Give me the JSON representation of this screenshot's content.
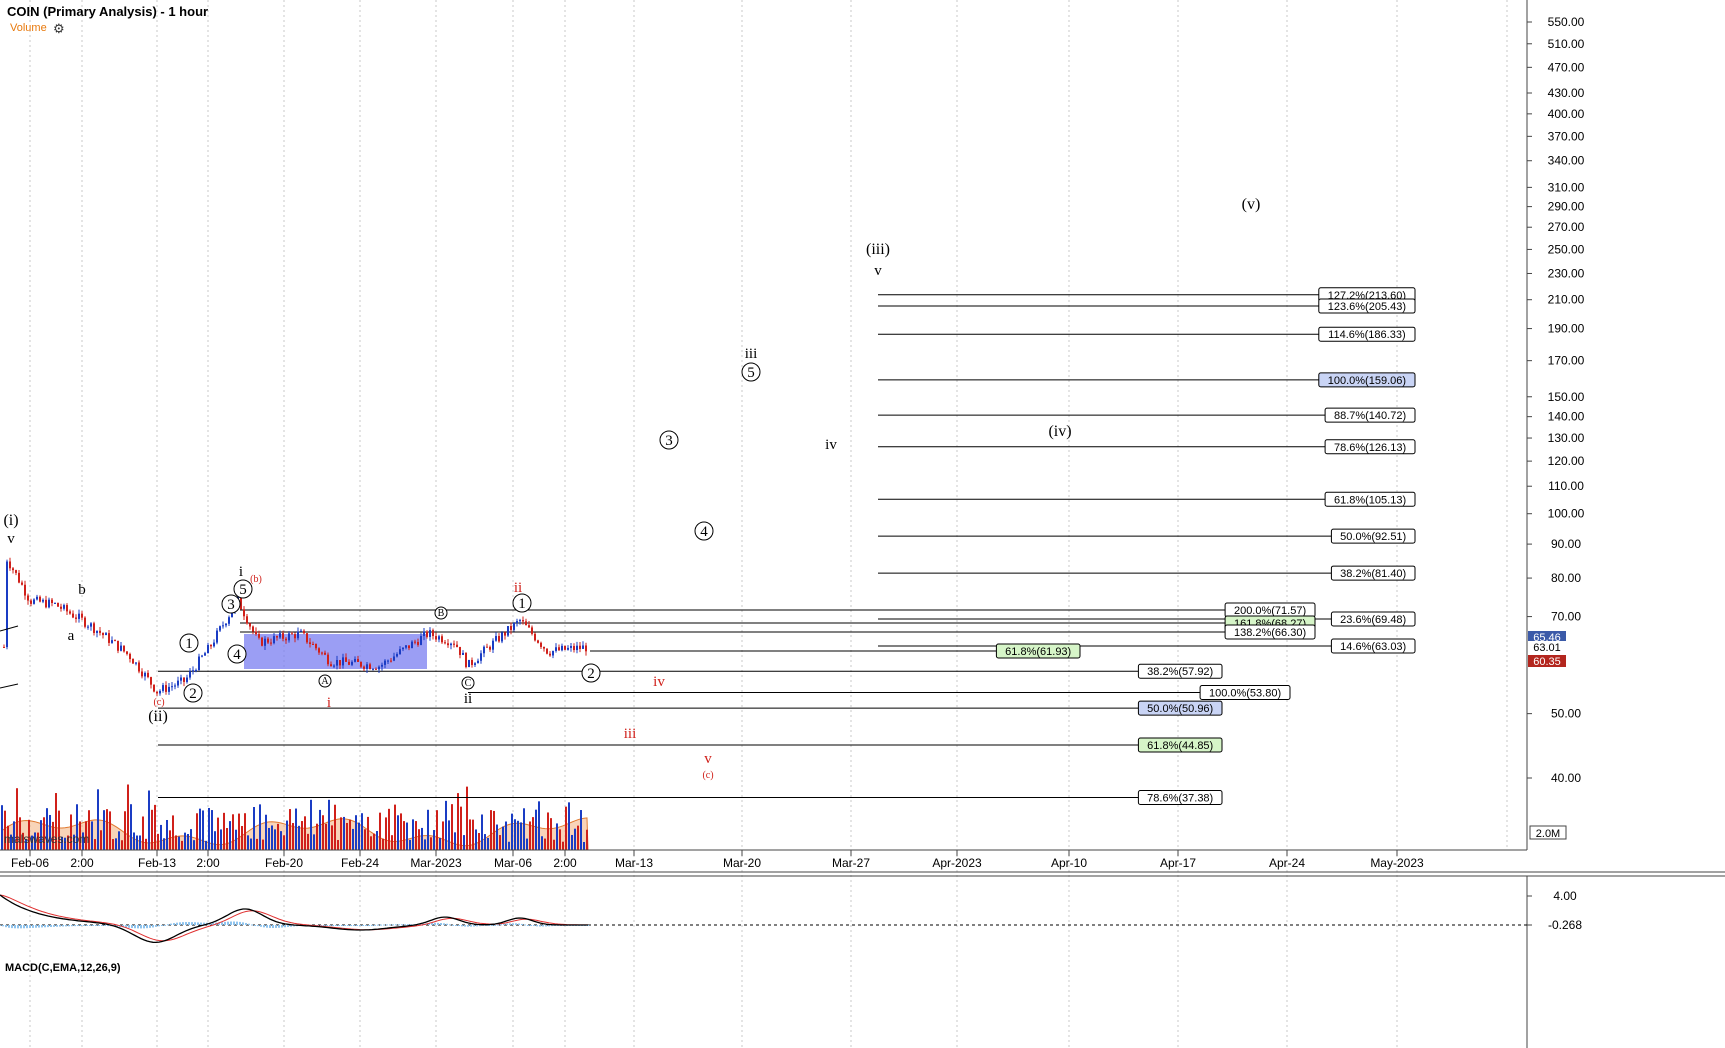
{
  "header": {
    "title": "COIN (Primary Analysis) - 1 hour",
    "volume_label": "Volume",
    "settings_icon": "gear-icon"
  },
  "watermark": "malswaves.com",
  "macd_label": "MACD(C,EMA,12,26,9)",
  "colors": {
    "up": "#1a3cc4",
    "down": "#d0201a",
    "red_label": "#d0201a",
    "box_fill": "#7a7ef0",
    "green_tag": "#d6f5c8",
    "blue_tag": "#c9d4f5",
    "macd_line": "#000000",
    "signal_line": "#e03030",
    "hist": "#8fc4ee",
    "vol_ema": "#f3b07e"
  },
  "chart_data": {
    "type": "candlestick",
    "title": "COIN (Primary Analysis) - 1 hour",
    "scale": "log",
    "ylim": [
      35,
      580
    ],
    "y_ticks": [
      "550.00",
      "510.00",
      "470.00",
      "430.00",
      "400.00",
      "370.00",
      "340.00",
      "310.00",
      "290.00",
      "270.00",
      "250.00",
      "230.00",
      "210.00",
      "190.00",
      "170.00",
      "150.00",
      "140.00",
      "130.00",
      "120.00",
      "110.00",
      "100.00",
      "90.00",
      "80.00",
      "70.00",
      "50.00",
      "40.00"
    ],
    "x_ticks": [
      "Feb-06",
      "2:00",
      "Feb-13",
      "2:00",
      "Feb-20",
      "Feb-24",
      "Mar-2023",
      "Mar-06",
      "2:00",
      "Mar-13",
      "Mar-20",
      "Mar-27",
      "Apr-2023",
      "Apr-10",
      "Apr-17",
      "Apr-24",
      "May-2023"
    ],
    "price_tags": [
      {
        "label": "65.46",
        "style": "blue"
      },
      {
        "label": "63.01",
        "style": "plain"
      },
      {
        "label": "60.35",
        "style": "red"
      }
    ],
    "volume_tag": "2.0M",
    "macd_ticks": [
      "4.00",
      "-0.268"
    ],
    "fib_levels": [
      {
        "label": "127.2%(213.60)",
        "value": 213.6,
        "style": "plain",
        "group": "upper"
      },
      {
        "label": "123.6%(205.43)",
        "value": 205.43,
        "style": "plain",
        "group": "upper"
      },
      {
        "label": "114.6%(186.33)",
        "value": 186.33,
        "style": "plain",
        "group": "upper"
      },
      {
        "label": "100.0%(159.06)",
        "value": 159.06,
        "style": "blue",
        "group": "upper"
      },
      {
        "label": "88.7%(140.72)",
        "value": 140.72,
        "style": "plain",
        "group": "upper"
      },
      {
        "label": "78.6%(126.13)",
        "value": 126.13,
        "style": "plain",
        "group": "upper"
      },
      {
        "label": "61.8%(105.13)",
        "value": 105.13,
        "style": "plain",
        "group": "upper"
      },
      {
        "label": "50.0%(92.51)",
        "value": 92.51,
        "style": "plain",
        "group": "upper"
      },
      {
        "label": "38.2%(81.40)",
        "value": 81.4,
        "style": "plain",
        "group": "upper"
      },
      {
        "label": "23.6%(69.48)",
        "value": 69.48,
        "style": "plain",
        "group": "upper"
      },
      {
        "label": "14.6%(63.03)",
        "value": 63.03,
        "style": "plain",
        "group": "upper"
      },
      {
        "label": "200.0%(71.57)",
        "value": 71.57,
        "style": "plain",
        "group": "mid"
      },
      {
        "label": "161.8%(68.27)",
        "value": 68.27,
        "style": "green",
        "group": "mid"
      },
      {
        "label": "138.2%(66.30)",
        "value": 66.3,
        "style": "plain",
        "group": "mid"
      },
      {
        "label": "61.8%(61.93)",
        "value": 61.93,
        "style": "green",
        "group": "short"
      },
      {
        "label": "38.2%(57.92)",
        "value": 57.92,
        "style": "plain",
        "group": "lower"
      },
      {
        "label": "100.0%(53.80)",
        "value": 53.8,
        "style": "plain",
        "group": "lower2"
      },
      {
        "label": "50.0%(50.96)",
        "value": 50.96,
        "style": "blue",
        "group": "lower"
      },
      {
        "label": "61.8%(44.85)",
        "value": 44.85,
        "style": "green",
        "group": "lower"
      },
      {
        "label": "78.6%(37.38)",
        "value": 37.38,
        "style": "plain",
        "group": "lower"
      }
    ],
    "wave_labels": [
      {
        "text": "(i)",
        "color": "black",
        "circled": false
      },
      {
        "text": "v",
        "color": "black",
        "circled": false
      },
      {
        "text": "a",
        "color": "black",
        "circled": false
      },
      {
        "text": "b",
        "color": "black",
        "circled": false
      },
      {
        "text": "(c)",
        "color": "red",
        "circled": false
      },
      {
        "text": "(ii)",
        "color": "black",
        "circled": false
      },
      {
        "text": "1",
        "color": "black",
        "circled": true
      },
      {
        "text": "2",
        "color": "black",
        "circled": true
      },
      {
        "text": "3",
        "color": "black",
        "circled": true
      },
      {
        "text": "4",
        "color": "black",
        "circled": true
      },
      {
        "text": "5",
        "color": "black",
        "circled": true
      },
      {
        "text": "i",
        "color": "black",
        "circled": false
      },
      {
        "text": "(b)",
        "color": "red",
        "circled": false
      },
      {
        "text": "A",
        "color": "black",
        "circled": true
      },
      {
        "text": "i",
        "color": "red",
        "circled": false
      },
      {
        "text": "B",
        "color": "black",
        "circled": true
      },
      {
        "text": "C",
        "color": "black",
        "circled": true
      },
      {
        "text": "ii",
        "color": "black",
        "circled": false
      },
      {
        "text": "ii",
        "color": "red",
        "circled": false
      },
      {
        "text": "1",
        "color": "black",
        "circled": true
      },
      {
        "text": "2",
        "color": "black",
        "circled": true
      },
      {
        "text": "iv",
        "color": "red",
        "circled": false
      },
      {
        "text": "iii",
        "color": "red",
        "circled": false
      },
      {
        "text": "v",
        "color": "red",
        "circled": false
      },
      {
        "text": "(c)",
        "color": "red",
        "circled": false
      },
      {
        "text": "3",
        "color": "black",
        "circled": true
      },
      {
        "text": "4",
        "color": "black",
        "circled": true
      },
      {
        "text": "iii",
        "color": "black",
        "circled": false
      },
      {
        "text": "5",
        "color": "black",
        "circled": true
      },
      {
        "text": "iv",
        "color": "black",
        "circled": false
      },
      {
        "text": "(iii)",
        "color": "black",
        "circled": false
      },
      {
        "text": "v",
        "color": "black",
        "circled": false
      },
      {
        "text": "(iv)",
        "color": "black",
        "circled": false
      },
      {
        "text": "(v)",
        "color": "black",
        "circled": false
      }
    ],
    "price_path": [
      {
        "t": "Feb-03",
        "close": 86
      },
      {
        "t": "Feb-06",
        "close": 74
      },
      {
        "t": "Feb-07",
        "close": 73
      },
      {
        "t": "Feb-08",
        "close": 68
      },
      {
        "t": "Feb-10",
        "close": 61
      },
      {
        "t": "Feb-13",
        "close": 54
      },
      {
        "t": "Feb-14",
        "close": 56
      },
      {
        "t": "Feb-15",
        "close": 63
      },
      {
        "t": "Feb-16",
        "close": 74
      },
      {
        "t": "Feb-17",
        "close": 64
      },
      {
        "t": "Feb-21",
        "close": 66
      },
      {
        "t": "Feb-22",
        "close": 60
      },
      {
        "t": "Feb-24",
        "close": 59
      },
      {
        "t": "Feb-28",
        "close": 66
      },
      {
        "t": "Mar-02",
        "close": 64
      },
      {
        "t": "Mar-03",
        "close": 59
      },
      {
        "t": "Mar-06",
        "close": 69
      },
      {
        "t": "Mar-07",
        "close": 62
      },
      {
        "t": "Mar-08",
        "close": 63
      }
    ]
  }
}
